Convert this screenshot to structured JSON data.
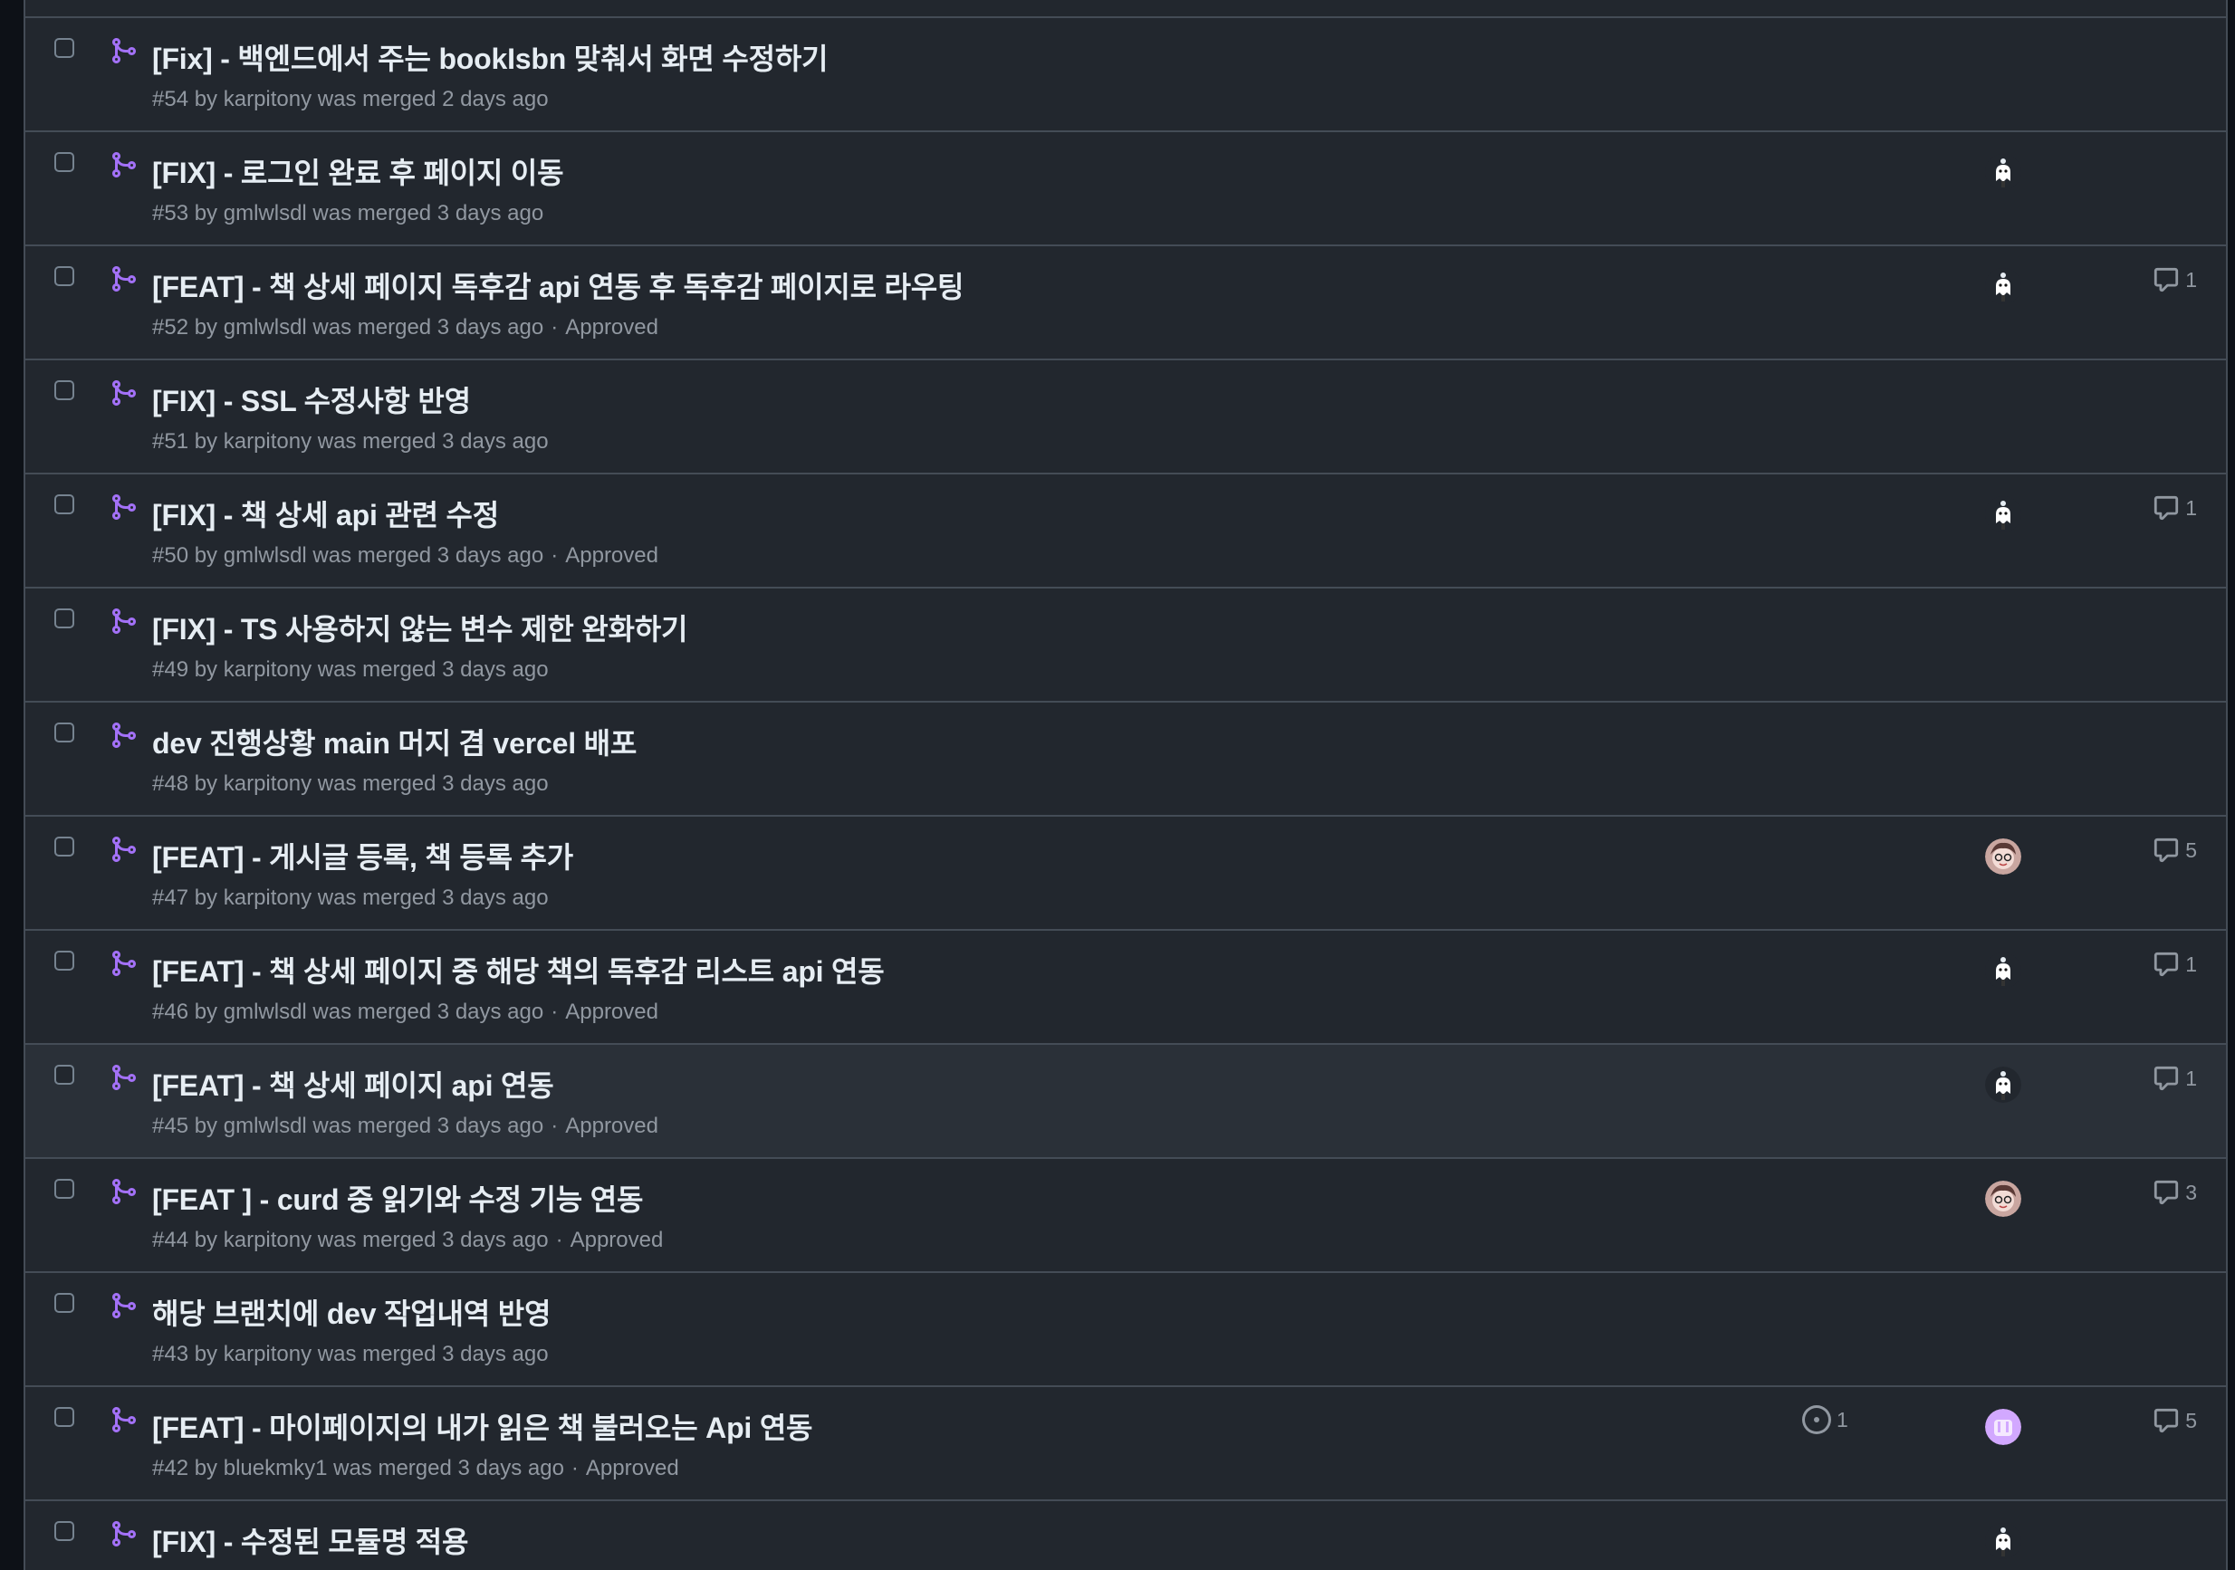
{
  "pull_requests": [
    {
      "title": "[Fix] - 백엔드에서 주는 bookIsbn 맞춰서 화면 수정하기",
      "meta": "#54 by karpitony was merged 2 days ago",
      "approved": "",
      "avatar": "",
      "comments": "",
      "linked_issues": ""
    },
    {
      "title": "[FIX] - 로그인 완료 후 페이지 이동",
      "meta": "#53 by gmlwlsdl was merged 3 days ago",
      "approved": "",
      "avatar": "ghost",
      "comments": "",
      "linked_issues": ""
    },
    {
      "title": "[FEAT] - 책 상세 페이지 독후감 api 연동 후 독후감 페이지로 라우팅",
      "meta": "#52 by gmlwlsdl was merged 3 days ago",
      "approved": "Approved",
      "avatar": "ghost",
      "comments": "1",
      "linked_issues": ""
    },
    {
      "title": "[FIX] - SSL 수정사항 반영",
      "meta": "#51 by karpitony was merged 3 days ago",
      "approved": "",
      "avatar": "",
      "comments": "",
      "linked_issues": ""
    },
    {
      "title": "[FIX] - 책 상세 api 관련 수정",
      "meta": "#50 by gmlwlsdl was merged 3 days ago",
      "approved": "Approved",
      "avatar": "ghost",
      "comments": "1",
      "linked_issues": ""
    },
    {
      "title": "[FIX] - TS 사용하지 않는 변수 제한 완화하기",
      "meta": "#49 by karpitony was merged 3 days ago",
      "approved": "",
      "avatar": "",
      "comments": "",
      "linked_issues": ""
    },
    {
      "title": "dev 진행상황 main 머지 겸 vercel 배포",
      "meta": "#48 by karpitony was merged 3 days ago",
      "approved": "",
      "avatar": "",
      "comments": "",
      "linked_issues": ""
    },
    {
      "title": "[FEAT] - 게시글 등록, 책 등록 추가",
      "meta": "#47 by karpitony was merged 3 days ago",
      "approved": "",
      "avatar": "face",
      "comments": "5",
      "linked_issues": ""
    },
    {
      "title": "[FEAT] - 책 상세 페이지 중 해당 책의 독후감 리스트 api 연동",
      "meta": "#46 by gmlwlsdl was merged 3 days ago",
      "approved": "Approved",
      "avatar": "ghost",
      "comments": "1",
      "linked_issues": ""
    },
    {
      "title": "[FEAT] - 책 상세 페이지 api 연동",
      "meta": "#45 by gmlwlsdl was merged 3 days ago",
      "approved": "Approved",
      "avatar": "ghost",
      "comments": "1",
      "linked_issues": ""
    },
    {
      "title": "[FEAT ] - curd 중 읽기와 수정 기능 연동",
      "meta": "#44 by karpitony was merged 3 days ago",
      "approved": "Approved",
      "avatar": "face",
      "comments": "3",
      "linked_issues": ""
    },
    {
      "title": "해당 브랜치에 dev 작업내역 반영",
      "meta": "#43 by karpitony was merged 3 days ago",
      "approved": "",
      "avatar": "",
      "comments": "",
      "linked_issues": ""
    },
    {
      "title": "[FEAT] - 마이페이지의 내가 읽은 책 불러오는 Api 연동",
      "meta": "#42 by bluekmky1 was merged 3 days ago",
      "approved": "Approved",
      "avatar": "purple",
      "comments": "5",
      "linked_issues": "1"
    },
    {
      "title": "[FIX] - 수정된 모듈명 적용",
      "meta": "",
      "approved": "",
      "avatar": "ghost",
      "comments": "",
      "linked_issues": ""
    }
  ],
  "colors": {
    "merged_icon": "#a371f7",
    "background": "#22272e",
    "border": "#444c56",
    "muted_text": "#9198a1"
  },
  "icons": {
    "row_icon": "git-merge-icon",
    "comment_icon": "comment-icon",
    "issue_icon": "issue-opened-icon"
  }
}
